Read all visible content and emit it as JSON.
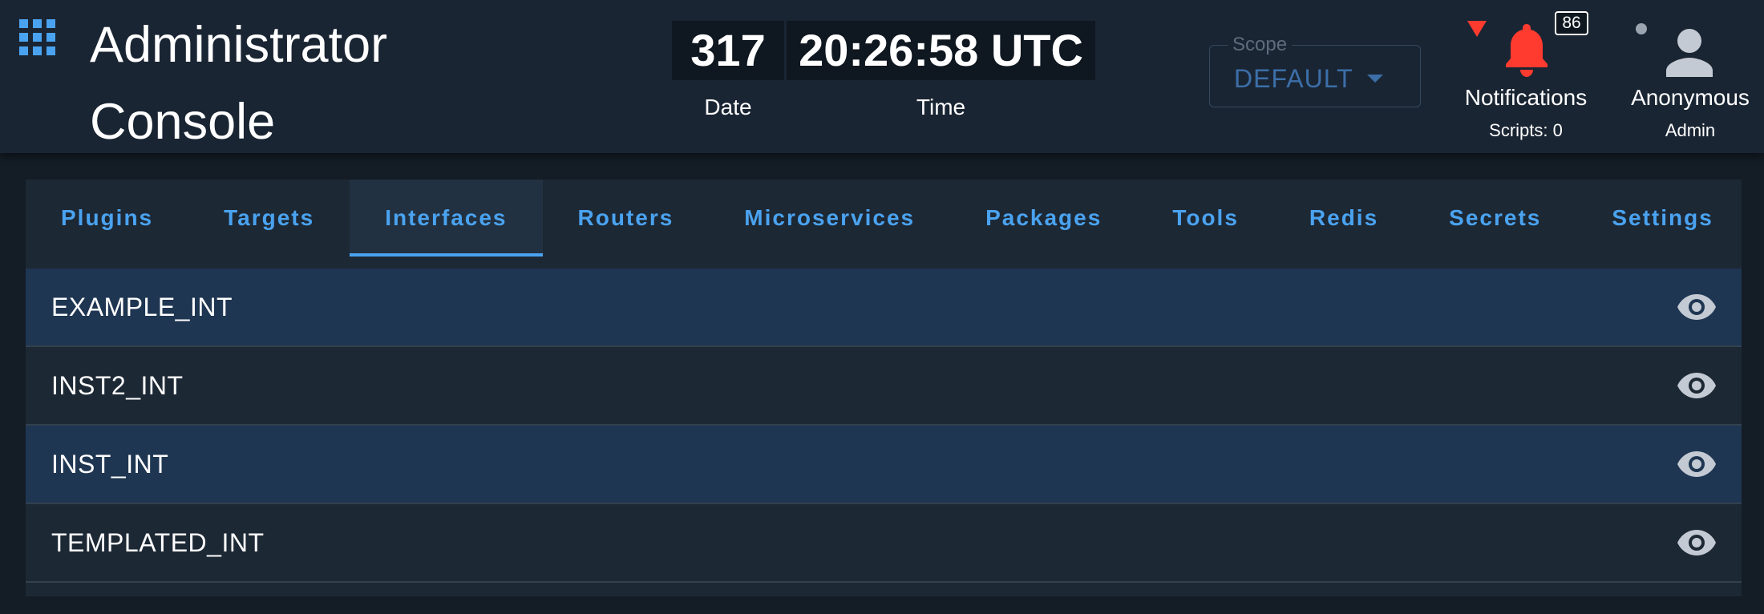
{
  "header": {
    "title": "Administrator Console",
    "apps_icon": "apps-grid-icon",
    "clock": {
      "date_value": "317",
      "date_label": "Date",
      "time_value": "20:26:58 UTC",
      "time_label": "Time"
    },
    "scope": {
      "label": "Scope",
      "value": "DEFAULT"
    },
    "notifications": {
      "icon": "bell-icon",
      "badge": "86",
      "label": "Notifications",
      "sub_label": "Scripts: 0"
    },
    "user": {
      "icon": "person-icon",
      "name": "Anonymous",
      "role": "Admin"
    }
  },
  "tabs": [
    {
      "label": "Plugins",
      "active": false
    },
    {
      "label": "Targets",
      "active": false
    },
    {
      "label": "Interfaces",
      "active": true
    },
    {
      "label": "Routers",
      "active": false
    },
    {
      "label": "Microservices",
      "active": false
    },
    {
      "label": "Packages",
      "active": false
    },
    {
      "label": "Tools",
      "active": false
    },
    {
      "label": "Redis",
      "active": false
    },
    {
      "label": "Secrets",
      "active": false
    },
    {
      "label": "Settings",
      "active": false
    }
  ],
  "interfaces": [
    {
      "name": "EXAMPLE_INT",
      "action_icon": "eye-icon"
    },
    {
      "name": "INST2_INT",
      "action_icon": "eye-icon"
    },
    {
      "name": "INST_INT",
      "action_icon": "eye-icon"
    },
    {
      "name": "TEMPLATED_INT",
      "action_icon": "eye-icon"
    }
  ],
  "colors": {
    "accent": "#4aa3f0",
    "alert": "#ff3b30",
    "header_bg": "#1a2533",
    "row_highlight": "#1f3652"
  }
}
